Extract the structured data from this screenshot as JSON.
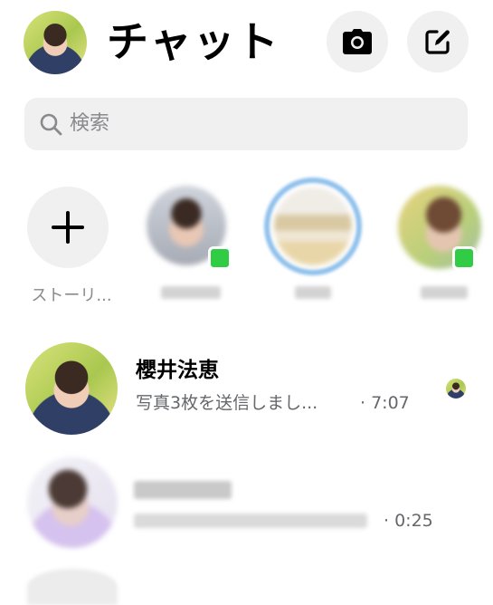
{
  "header": {
    "title": "チャット",
    "avatar_icon": "user-avatar",
    "camera_icon": "camera-icon",
    "compose_icon": "compose-icon"
  },
  "search": {
    "placeholder": "検索",
    "icon": "search-icon"
  },
  "stories": {
    "add_label": "ストーリ...",
    "add_icon": "plus-icon",
    "online_color": "#31cc46",
    "active_ring_color": "#8ec0ec"
  },
  "chats": [
    {
      "name": "櫻井法恵",
      "preview": "写真3枚を送信しまし...",
      "time": "· 7:07",
      "read_receipt": "user-avatar"
    },
    {
      "time": "· 0:25"
    }
  ],
  "colors": {
    "background": "#ffffff",
    "control_bg": "#f0f0f0",
    "secondary_text": "#65676b"
  }
}
